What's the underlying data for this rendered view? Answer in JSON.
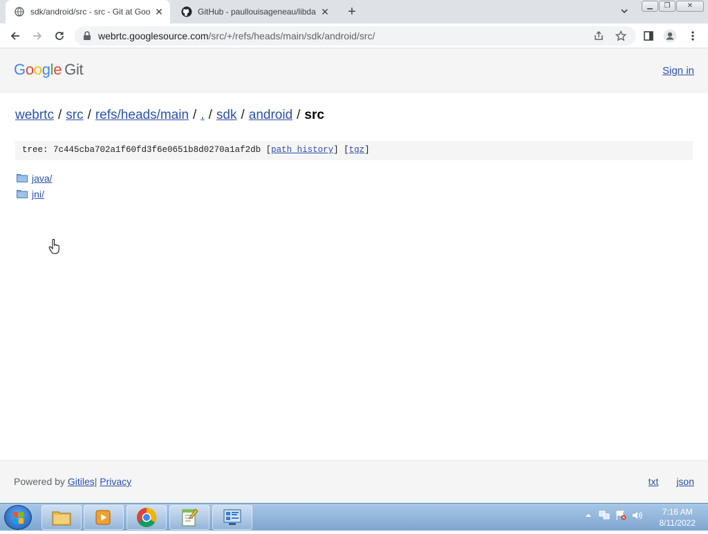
{
  "browser": {
    "tabs": [
      {
        "title": "sdk/android/src - src - Git at Goo",
        "active": true,
        "favicon": "globe-icon"
      },
      {
        "title": "GitHub - paullouisageneau/libda",
        "active": false,
        "favicon": "github-icon"
      }
    ],
    "url_host": "webrtc.googlesource.com",
    "url_path": "/src/+/refs/heads/main/sdk/android/src/"
  },
  "header": {
    "logo_text": "Google",
    "logo_suffix": "Git",
    "signin": "Sign in"
  },
  "breadcrumbs": {
    "items": [
      "webrtc",
      "src",
      "refs/heads/main",
      ".",
      "sdk",
      "android"
    ],
    "current": "src"
  },
  "tree": {
    "label": "tree:",
    "hash": "7c445cba702a1f60fd3f6e0651b8d0270a1af2db",
    "path_history": "path history",
    "tgz": "tgz"
  },
  "files": [
    {
      "name": "java/"
    },
    {
      "name": "jni/"
    }
  ],
  "footer": {
    "powered_by": "Powered by",
    "gitiles": "Gitiles",
    "privacy": "Privacy",
    "txt": "txt",
    "json": "json"
  },
  "taskbar": {
    "time": "7:16 AM",
    "date": "8/11/2022"
  }
}
